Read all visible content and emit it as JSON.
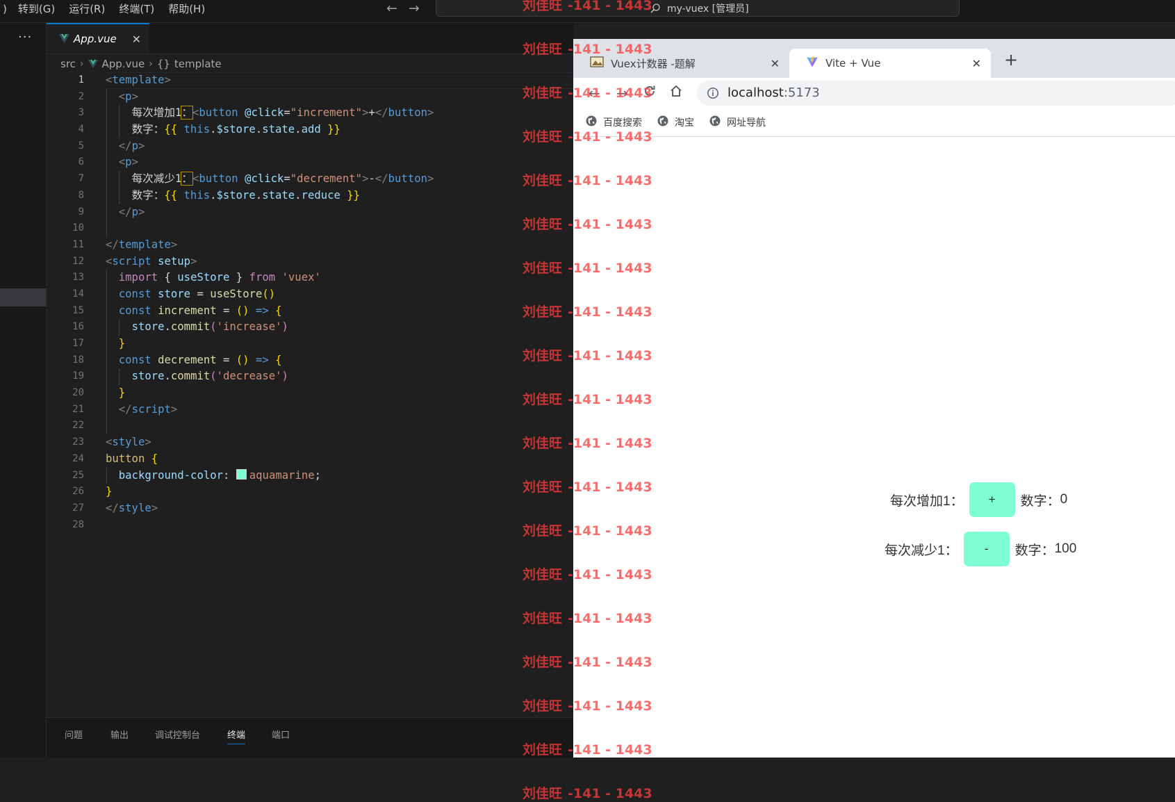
{
  "menu": {
    "partial": ")",
    "items": [
      "转到(G)",
      "运行(R)",
      "终端(T)",
      "帮助(H)"
    ]
  },
  "command_center": {
    "text": "my-vuex [管理员]",
    "icon": "search-icon"
  },
  "activity_bar": {
    "more": "···"
  },
  "editor": {
    "tab": {
      "name": "App.vue",
      "close": "✕"
    },
    "breadcrumb": {
      "folder": "src",
      "file": "App.vue",
      "symbol_icon": "{}",
      "symbol": "template"
    },
    "line_numbers": [
      "1",
      "2",
      "3",
      "4",
      "5",
      "6",
      "7",
      "8",
      "9",
      "10",
      "11",
      "12",
      "13",
      "14",
      "15",
      "16",
      "17",
      "18",
      "19",
      "20",
      "21",
      "22",
      "23",
      "24",
      "25",
      "26",
      "27",
      "28"
    ],
    "code": {
      "l1": [
        "<",
        "template",
        ">"
      ],
      "l2": [
        "<",
        "p",
        ">"
      ],
      "l3": [
        "每次增加1",
        "：",
        "<",
        "button",
        " ",
        "@click",
        "=",
        "\"increment\"",
        ">",
        "+",
        "</",
        "button",
        ">"
      ],
      "l4": [
        "数字：",
        "{{",
        " this",
        ".",
        "$store",
        ".",
        "state",
        ".",
        "add",
        " }}"
      ],
      "l5": [
        "</",
        "p",
        ">"
      ],
      "l6": [
        "<",
        "p",
        ">"
      ],
      "l7": [
        "每次减少1",
        "：",
        "<",
        "button",
        " ",
        "@click",
        "=",
        "\"decrement\"",
        ">",
        "-",
        "</",
        "button",
        ">"
      ],
      "l8": [
        "数字：",
        "{{",
        " this",
        ".",
        "$store",
        ".",
        "state",
        ".",
        "reduce",
        " }}"
      ],
      "l9": [
        "</",
        "p",
        ">"
      ],
      "l11": [
        "</",
        "template",
        ">"
      ],
      "l12": [
        "<",
        "script",
        " ",
        "setup",
        ">"
      ],
      "l13": [
        "import",
        " { ",
        "useStore",
        " } ",
        "from",
        " ",
        "'vuex'"
      ],
      "l14": [
        "const",
        " ",
        "store",
        " = ",
        "useStore",
        "()"
      ],
      "l15": [
        "const",
        " ",
        "increment",
        " = ",
        "()",
        " => ",
        "{"
      ],
      "l16": [
        "store",
        ".",
        "commit",
        "(",
        "'increase'",
        ")"
      ],
      "l17": [
        "}"
      ],
      "l18": [
        "const",
        " ",
        "decrement",
        " = ",
        "()",
        " => ",
        "{"
      ],
      "l19": [
        "store",
        ".",
        "commit",
        "(",
        "'decrease'",
        ")"
      ],
      "l20": [
        "}"
      ],
      "l21": [
        "</",
        "script",
        ">"
      ],
      "l23": [
        "<",
        "style",
        ">"
      ],
      "l24": [
        "button",
        " ",
        "{"
      ],
      "l25": [
        "background-color",
        ": ",
        "aquamarine",
        ";"
      ],
      "l26": [
        "}"
      ],
      "l27": [
        "</",
        "style",
        ">"
      ]
    },
    "swatch_color": "#7fffd4"
  },
  "panel": {
    "tabs": [
      "问题",
      "输出",
      "调试控制台",
      "终端",
      "端口"
    ],
    "active": "终端"
  },
  "browser": {
    "tabs": [
      {
        "title": "Vuex计数器 -题解",
        "close": "✕"
      },
      {
        "title": "Vite + Vue",
        "close": "✕"
      }
    ],
    "new_tab": "+",
    "url": {
      "host": "localhost",
      "port": ":5173"
    },
    "bookmarks": [
      "百度搜索",
      "淘宝",
      "网址导航"
    ],
    "page": {
      "row1": {
        "label": "每次增加1：",
        "button": "+",
        "count_label": "数字：",
        "count": "0"
      },
      "row2": {
        "label": "每次减少1：",
        "button": "-",
        "count_label": "数字：",
        "count": "100"
      }
    },
    "button_color": "#7fffd4"
  },
  "watermark": {
    "text_name": "刘佳旺",
    "text_nums": "-141 - 1443"
  }
}
